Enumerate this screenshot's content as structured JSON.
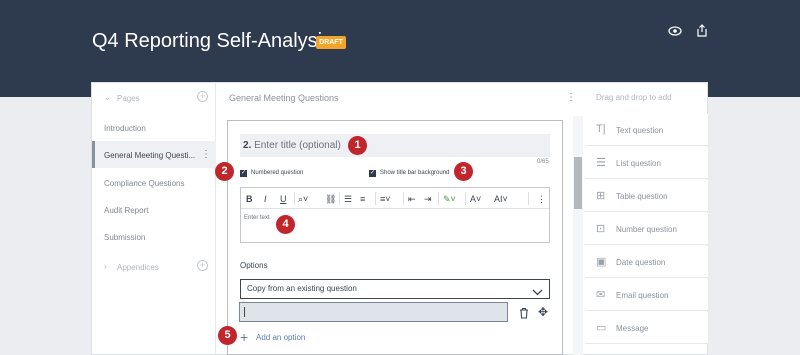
{
  "header": {
    "title": "Q4 Reporting Self-Analysis",
    "draft_badge": "DRAFT"
  },
  "left": {
    "pages_label": "Pages",
    "pages": [
      "Introduction",
      "General Meeting Questi...",
      "Compliance Questions",
      "Audit Report",
      "Submission"
    ],
    "appendices_label": "Appendices"
  },
  "center": {
    "header_title": "General Meeting Questions",
    "question": {
      "number": "2.",
      "title_placeholder": "Enter title (optional)",
      "counter": "0/65",
      "numbered_label": "Numbered question",
      "titlebar_label": "Show title bar background",
      "editor_placeholder": "Enter text",
      "toolbar": {
        "bold": "B",
        "italic": "I",
        "underline": "U",
        "font_size": "AI"
      },
      "options_label": "Options",
      "copy_select": "Copy from an existing question",
      "add_option": "Add an option"
    }
  },
  "right": {
    "header": "Drag and drop to add",
    "tools": [
      {
        "icon": "text-icon",
        "label": "Text question"
      },
      {
        "icon": "list-icon",
        "label": "List question"
      },
      {
        "icon": "table-icon",
        "label": "Table question"
      },
      {
        "icon": "number-icon",
        "label": "Number question"
      },
      {
        "icon": "date-icon",
        "label": "Date question"
      },
      {
        "icon": "email-icon",
        "label": "Email question"
      },
      {
        "icon": "message-icon",
        "label": "Message"
      }
    ]
  },
  "callouts": [
    "1",
    "2",
    "3",
    "4",
    "5"
  ],
  "colors": {
    "header_bg": "#2e3a4e",
    "draft": "#f2a42b",
    "callout": "#c0262c",
    "link": "#5b7fb5"
  }
}
